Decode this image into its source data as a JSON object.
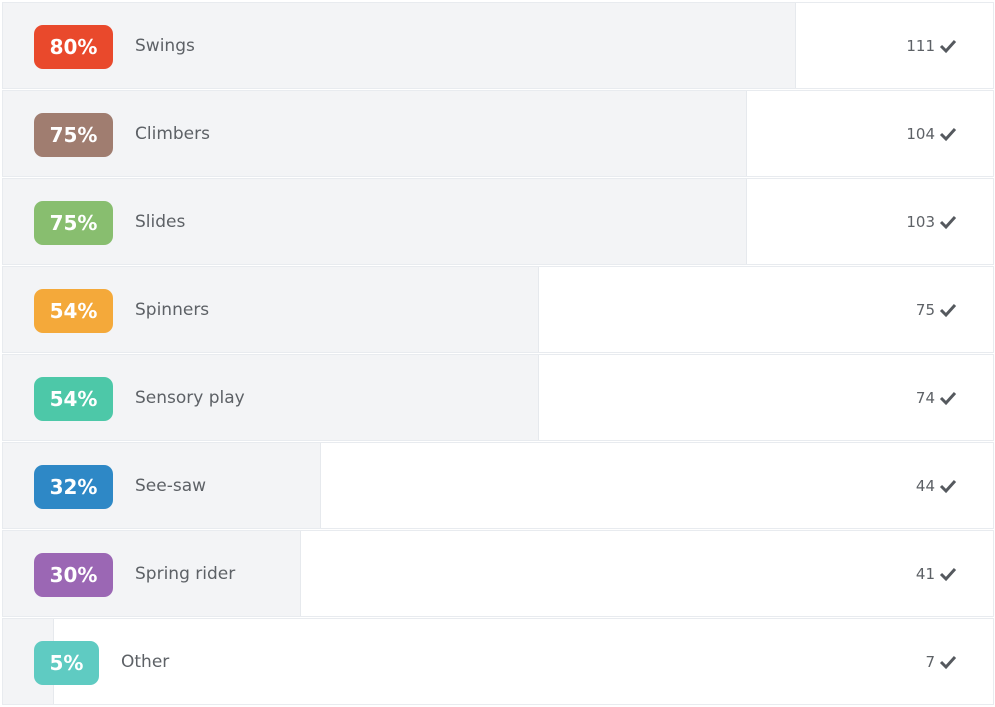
{
  "poll": {
    "options": [
      {
        "percent": "80%",
        "fraction": 0.8,
        "label": "Swings",
        "count": "111",
        "color": "#e9492c"
      },
      {
        "percent": "75%",
        "fraction": 0.75,
        "label": "Climbers",
        "count": "104",
        "color": "#a07d70"
      },
      {
        "percent": "75%",
        "fraction": 0.75,
        "label": "Slides",
        "count": "103",
        "color": "#88be6f"
      },
      {
        "percent": "54%",
        "fraction": 0.54,
        "label": "Spinners",
        "count": "75",
        "color": "#f4a93a"
      },
      {
        "percent": "54%",
        "fraction": 0.54,
        "label": "Sensory play",
        "count": "74",
        "color": "#4dc8a8"
      },
      {
        "percent": "32%",
        "fraction": 0.32,
        "label": "See-saw",
        "count": "44",
        "color": "#2e88c6"
      },
      {
        "percent": "30%",
        "fraction": 0.3,
        "label": "Spring rider",
        "count": "41",
        "color": "#9b67b4"
      },
      {
        "percent": "5%",
        "fraction": 0.05,
        "label": "Other",
        "count": "7",
        "color": "#5fcbc2"
      }
    ],
    "icon": "checkmark-icon"
  }
}
